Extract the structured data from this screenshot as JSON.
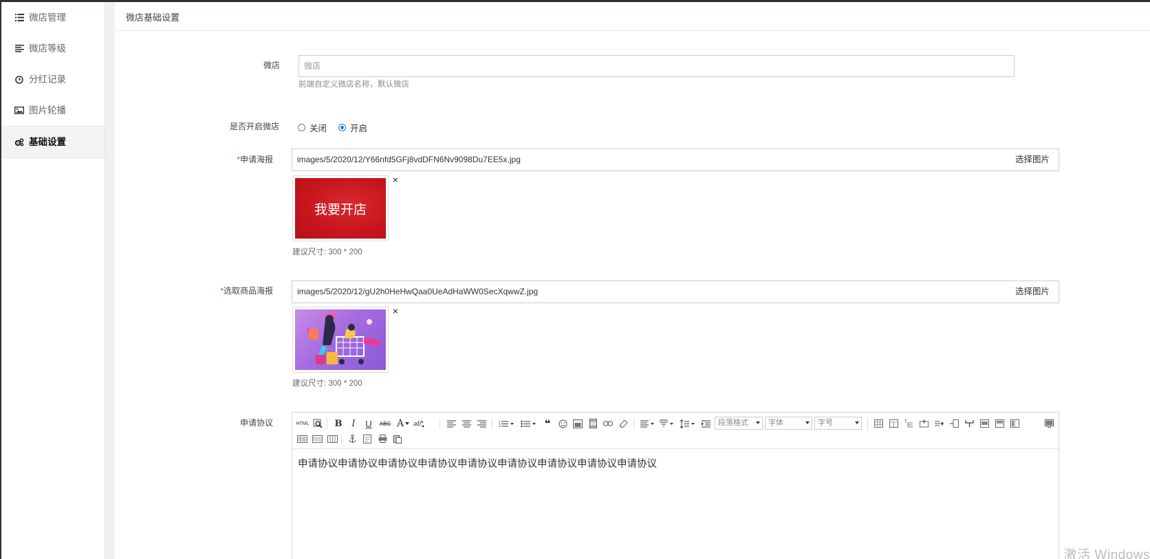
{
  "sidebar": {
    "items": [
      {
        "label": "微店管理",
        "icon": "list-icon",
        "active": false
      },
      {
        "label": "微店等级",
        "icon": "align-left-icon",
        "active": false
      },
      {
        "label": "分红记录",
        "icon": "clock-icon",
        "active": false
      },
      {
        "label": "图片轮播",
        "icon": "image-icon",
        "active": false
      },
      {
        "label": "基础设置",
        "icon": "cogs-icon",
        "active": true
      }
    ]
  },
  "page": {
    "title": "微店基础设置"
  },
  "form": {
    "shop_name": {
      "label": "微店",
      "placeholder": "微店",
      "value": "",
      "hint": "前端自定义微店名称，默认微店"
    },
    "open_shop": {
      "label": "是否开启微店",
      "options": [
        {
          "label": "关闭",
          "checked": false
        },
        {
          "label": "开启",
          "checked": true
        }
      ]
    },
    "apply_poster": {
      "required_mark": "*",
      "label": "申请海报",
      "value": "images/5/2020/12/Y66nfd5GFj8vdDFN6Nv9098Du7EE5x.jpg",
      "button": "选择图片",
      "remove": "×",
      "image_text": "我要开店",
      "hint": "建议尺寸: 300 * 200"
    },
    "goods_poster": {
      "required_mark": "*",
      "label": "选取商品海报",
      "value": "images/5/2020/12/gU2h0HeHwQaa0UeAdHaWW0SecXqwwZ.jpg",
      "button": "选择图片",
      "remove": "×",
      "hint": "建议尺寸: 300 * 200"
    },
    "agreement": {
      "label": "申请协议",
      "toolbar": {
        "html": "HTML",
        "bold": "B",
        "italic": "I",
        "underline": "U",
        "strike": "ABC",
        "font_color": "A",
        "paragraph_select": "段落格式",
        "font_select": "字体",
        "size_select": "字号"
      },
      "content": "申请协议申请协议申请协议申请协议申请协议申请协议申请协议申请协议申请协议"
    }
  },
  "watermark": "激活 Windows",
  "colors": {
    "accent": "#1f75d6",
    "required": "#e4393c",
    "poster_red": "#c8161d"
  }
}
